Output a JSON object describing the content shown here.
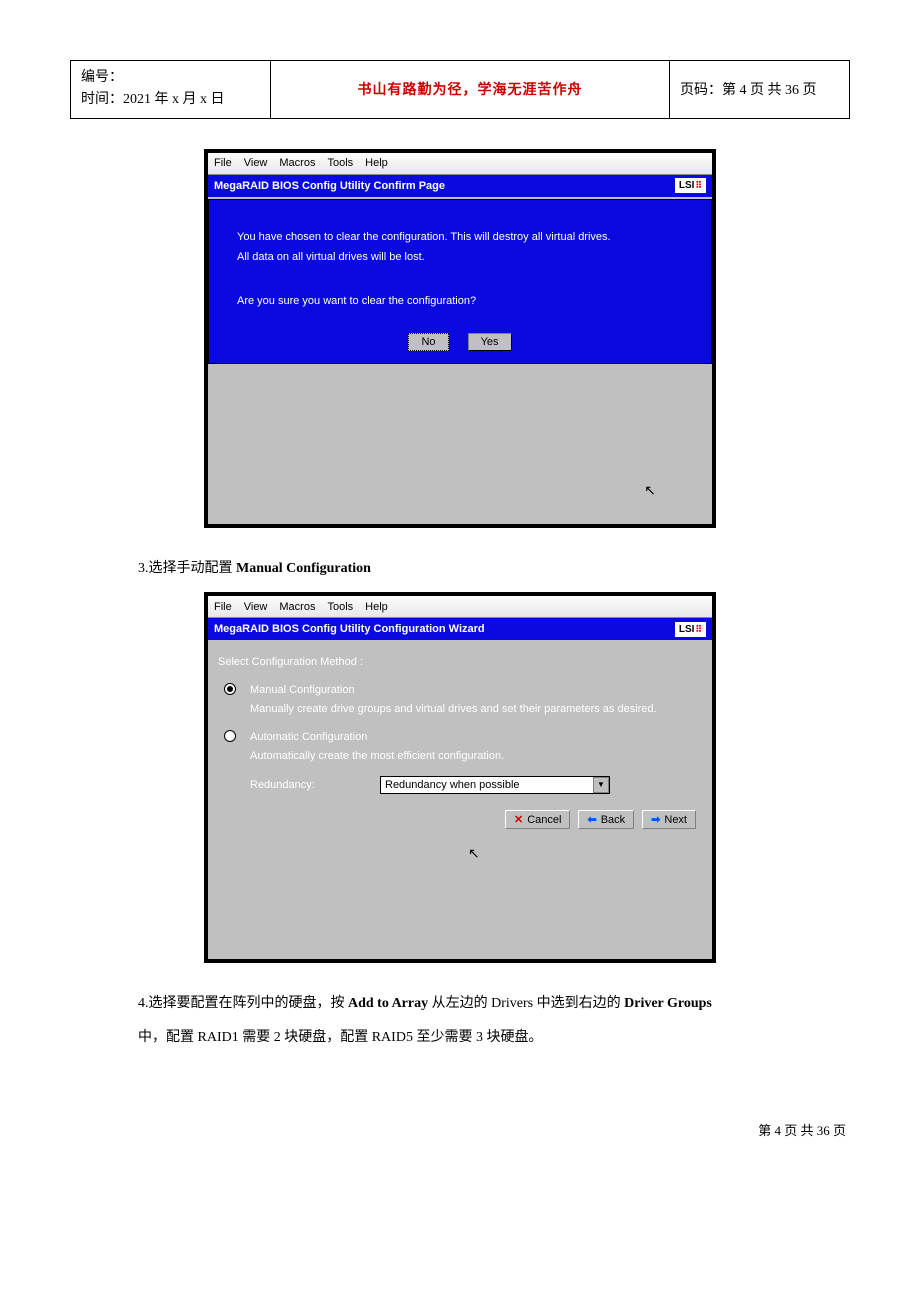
{
  "header": {
    "number_label": "编号：",
    "time_label": "时间：2021 年 x 月 x 日",
    "center": "书山有路勤为径，学海无涯苦作舟",
    "page_label": "页码：第 4 页 共 36 页"
  },
  "screenshot1": {
    "menu": {
      "file": "File",
      "view": "View",
      "macros": "Macros",
      "tools": "Tools",
      "help": "Help"
    },
    "title": "MegaRAID BIOS Config Utility Confirm Page",
    "logo": "LSI",
    "line1": "You have chosen to clear the configuration. This will destroy all virtual drives.",
    "line2": "All data on all virtual drives will be lost.",
    "line3": "Are you sure you want to clear the configuration?",
    "no": "No",
    "yes": "Yes"
  },
  "step3": {
    "prefix": "3.选择手动配置 ",
    "bold": "Manual Configuration"
  },
  "screenshot2": {
    "menu": {
      "file": "File",
      "view": "View",
      "macros": "Macros",
      "tools": "Tools",
      "help": "Help"
    },
    "title": "MegaRAID BIOS Config Utility Configuration Wizard",
    "logo": "LSI",
    "select_label": "Select Configuration Method :",
    "manual_title": "Manual Configuration",
    "manual_desc": "Manually create drive groups and virtual drives and set their parameters as desired.",
    "auto_title": "Automatic Configuration",
    "auto_desc": "Automatically create the most efficient configuration.",
    "redundancy_label": "Redundancy:",
    "redundancy_value": "Redundancy when possible",
    "cancel": "Cancel",
    "back": "Back",
    "next": "Next"
  },
  "step4": {
    "p1a": "4.选择要配置在阵列中的硬盘，按 ",
    "p1b": "Add to Array",
    "p1c": " 从左边的 Drivers 中选到右边的 ",
    "p1d": "Driver Groups",
    "p2": "中，配置 RAID1 需要 2 块硬盘，配置 RAID5 至少需要 3 块硬盘。"
  },
  "footer": "第 4 页 共 36 页"
}
